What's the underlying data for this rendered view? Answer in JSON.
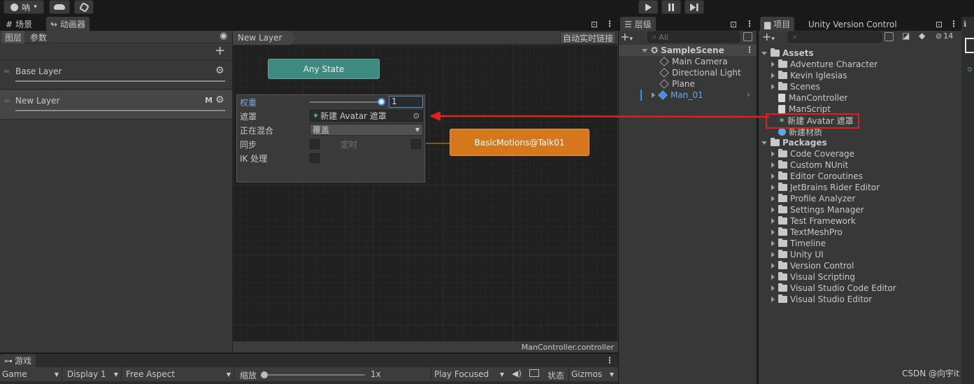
{
  "toolbar": {
    "account": "呐",
    "account_caret": "▾",
    "play_icon": "play-icon",
    "pause_icon": "pause-icon",
    "step_icon": "step-icon"
  },
  "tabs": {
    "scene": "场景",
    "animator": "动画器",
    "hierarchy": "层级",
    "project": "项目",
    "vcs": "Unity Version Control",
    "game": "游戏"
  },
  "animator": {
    "sub_layers": "图层",
    "sub_params": "参数",
    "breadcrumb": "New Layer",
    "auto_live": "自动实时链接",
    "layers": [
      {
        "name": "Base Layer",
        "m": ""
      },
      {
        "name": "New Layer",
        "m": "M"
      }
    ],
    "states": {
      "any": "Any State",
      "motion": "BasicMotions@Talk01"
    },
    "footer": "ManController.controller",
    "settings": {
      "weight_label": "权重",
      "weight_value": "1",
      "weight_fraction": 1,
      "mask_label": "遮罩",
      "mask_value": "新建 Avatar 遮罩",
      "blend_label": "正在混合",
      "blend_value": "覆盖",
      "sync_label": "同步",
      "timing_label": "定时",
      "ik_label": "IK 处理"
    }
  },
  "hierarchy": {
    "search_placeholder": "All",
    "scene": "SampleScene",
    "items": [
      "Main Camera",
      "Directional Light",
      "Plane",
      "Man_01"
    ]
  },
  "project": {
    "search_placeholder": "",
    "hidden_count": "14",
    "assets_label": "Assets",
    "assets": [
      "Adventure Character",
      "Kevin Iglesias",
      "Scenes",
      "ManController",
      "ManScript",
      "新建 Avatar 遮罩",
      "新建材质"
    ],
    "packages_label": "Packages",
    "packages": [
      "Code Coverage",
      "Custom NUnit",
      "Editor Coroutines",
      "JetBrains Rider Editor",
      "Profile Analyzer",
      "Settings Manager",
      "Test Framework",
      "TextMeshPro",
      "Timeline",
      "Unity UI",
      "Version Control",
      "Visual Scripting",
      "Visual Studio Code Editor",
      "Visual Studio Editor"
    ]
  },
  "game": {
    "mode": "Game",
    "display": "Display 1",
    "aspect": "Free Aspect",
    "scale_label": "缩放",
    "scale_value": "1x",
    "play_focused": "Play Focused",
    "stats": "状态",
    "gizmos": "Gizmos"
  },
  "watermark": "CSDN @向宇it",
  "colors": {
    "accent": "#4c8fd6",
    "highlight": "#e02020",
    "any_state": "#3e8a80",
    "motion_state": "#d5771d"
  }
}
